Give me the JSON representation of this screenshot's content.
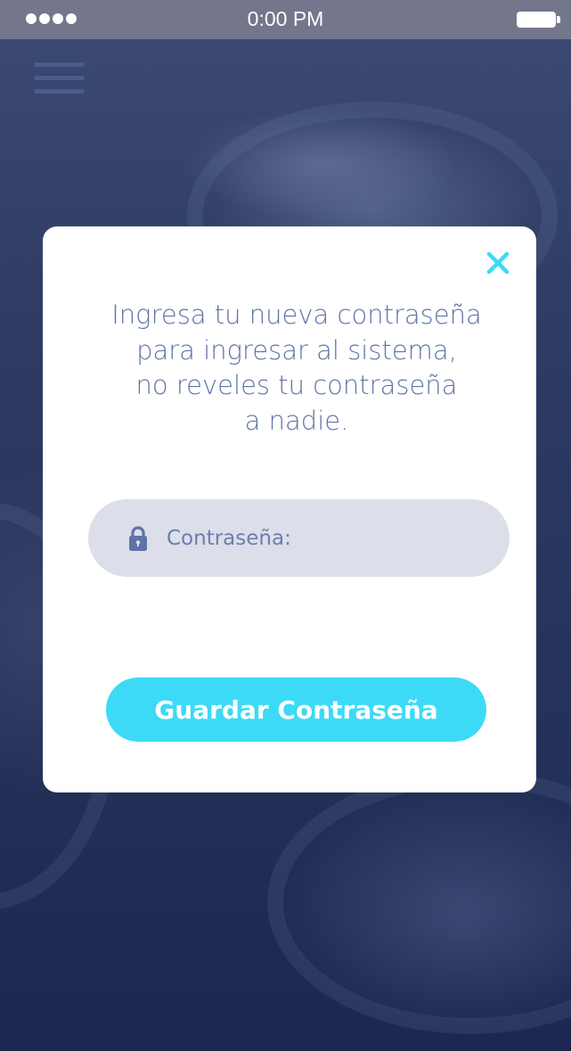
{
  "status_bar": {
    "time": "0:00 PM"
  },
  "menu": {
    "icon": "hamburger-menu-icon"
  },
  "dialog": {
    "close_icon": "close-icon",
    "message_lines": [
      "Ingresa tu nueva contraseña",
      "para ingresar al sistema,",
      "no reveles tu contraseña",
      "a nadie."
    ],
    "password_field": {
      "icon": "lock-icon",
      "placeholder": "Contraseña:",
      "value": ""
    },
    "save_button_label": "Guardar Contraseña"
  },
  "colors": {
    "accent": "#3cdaf7",
    "text": "#5f73a6",
    "field_background": "#dcdfe9",
    "status_bar": "#74768b",
    "background": "#25325a"
  }
}
